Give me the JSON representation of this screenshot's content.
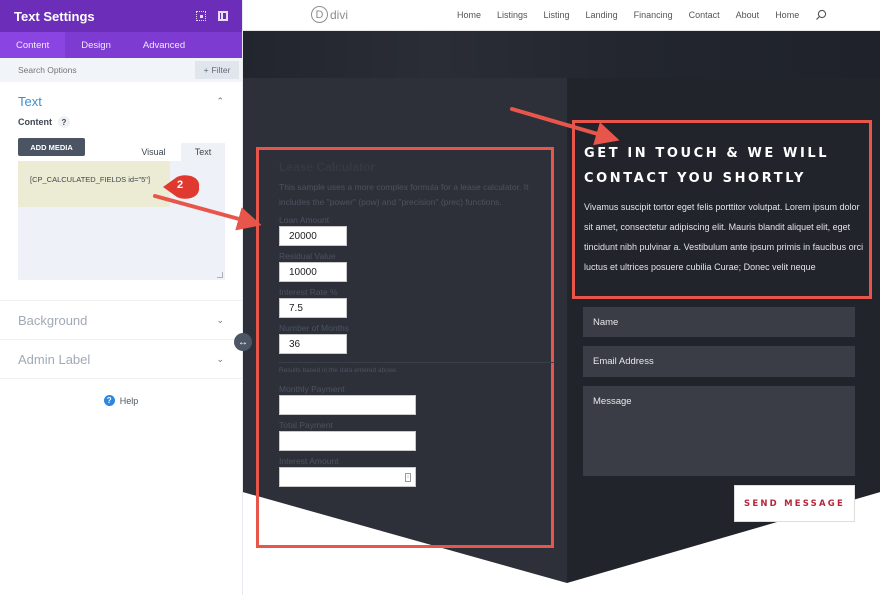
{
  "panel": {
    "title": "Text Settings",
    "header_icons": [
      "expand-icon",
      "split-view-icon"
    ],
    "tabs": [
      {
        "label": "Content",
        "active": true
      },
      {
        "label": "Design",
        "active": false
      },
      {
        "label": "Advanced",
        "active": false
      }
    ],
    "search_placeholder": "Search Options",
    "filter_label": "Filter",
    "filter_icon": "+",
    "sections": {
      "text": {
        "title": "Text",
        "open": true
      },
      "background": {
        "title": "Background",
        "open": false
      },
      "admin_label": {
        "title": "Admin Label",
        "open": false
      }
    },
    "content_label": "Content",
    "content_help": "?",
    "add_media_label": "ADD MEDIA",
    "editor_tabs": {
      "visual": "Visual",
      "text": "Text"
    },
    "editor_value": "[CP_CALCULATED_FIELDS id=\"5\"]",
    "help_label": "Help",
    "help_icon": "?",
    "drag_handle_glyph": "↔"
  },
  "annotation": {
    "badge_number": "2",
    "color": "#e8564b"
  },
  "site": {
    "logo_mark": "D",
    "logo_text": "divi",
    "nav": [
      "Home",
      "Listings",
      "Listing",
      "Landing",
      "Financing",
      "Contact",
      "About",
      "Home"
    ],
    "calculator": {
      "title": "Lease Calculator",
      "description": "This sample uses a more complex formula for a lease calculator. It includes the \"power\" (pow) and \"precision\" (prec) functions.",
      "inputs": [
        {
          "label": "Loan Amount",
          "value": "20000"
        },
        {
          "label": "Residual Value",
          "value": "10000"
        },
        {
          "label": "Interest Rate %",
          "value": "7.5"
        },
        {
          "label": "Number of Months",
          "value": "36"
        }
      ],
      "note": "Results based in the data entered above.",
      "outputs": [
        {
          "label": "Monthly Payment",
          "value": ""
        },
        {
          "label": "Total Payment",
          "value": ""
        },
        {
          "label": "Interest Amount",
          "value": ""
        }
      ]
    },
    "contact": {
      "title_line1": "GET IN TOUCH & WE WILL",
      "title_line2": "CONTACT YOU SHORTLY",
      "body": "Vivamus suscipit tortor eget felis porttitor volutpat. Lorem ipsum dolor sit amet, consectetur adipiscing elit. Mauris blandit aliquet elit, eget tincidunt nibh pulvinar a. Vestibulum ante ipsum primis in faucibus orci luctus et ultrices posuere cubilia Curae; Donec velit neque",
      "name_placeholder": "Name",
      "email_placeholder": "Email Address",
      "message_placeholder": "Message",
      "send_label": "SEND MESSAGE"
    }
  }
}
